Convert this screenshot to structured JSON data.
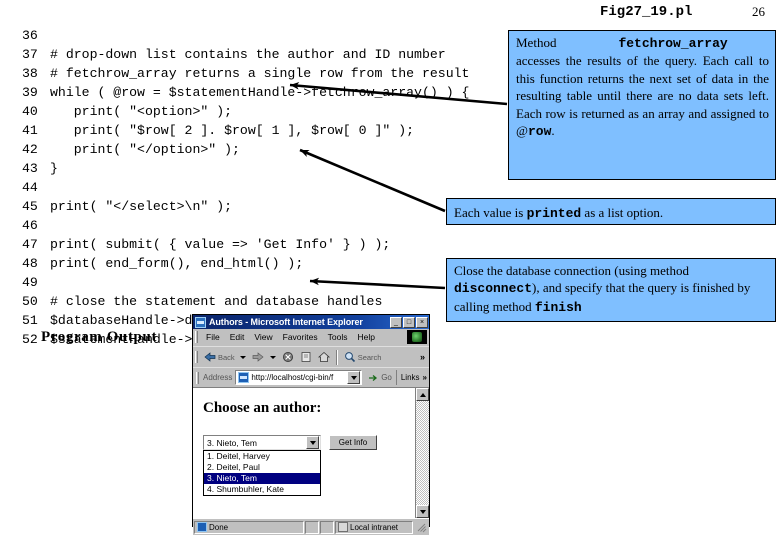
{
  "header": {
    "figure_title": "Fig27_19.pl",
    "page_number": "26"
  },
  "code": {
    "lines": [
      {
        "no": "36",
        "text": ""
      },
      {
        "no": "37",
        "text": "# drop-down list contains the author and ID number"
      },
      {
        "no": "38",
        "text": "# fetchrow_array returns a single row from the result"
      },
      {
        "no": "39",
        "text": "while ( @row = $statementHandle->fetchrow_array() ) {"
      },
      {
        "no": "40",
        "text": "   print( \"<option>\" );"
      },
      {
        "no": "41",
        "text": "   print( \"$row[ 2 ]. $row[ 1 ], $row[ 0 ]\" );"
      },
      {
        "no": "42",
        "text": "   print( \"</option>\" );"
      },
      {
        "no": "43",
        "text": "}"
      },
      {
        "no": "44",
        "text": ""
      },
      {
        "no": "45",
        "text": "print( \"</select>\\n\" );"
      },
      {
        "no": "46",
        "text": ""
      },
      {
        "no": "47",
        "text": "print( submit( { value => 'Get Info' } ) );"
      },
      {
        "no": "48",
        "text": "print( end_form(), end_html() );"
      },
      {
        "no": "49",
        "text": ""
      },
      {
        "no": "50",
        "text": "# close the statement and database handles"
      },
      {
        "no": "51",
        "text": "$databaseHandle->disconnect();"
      },
      {
        "no": "52",
        "text": "$statementHandle->finish();"
      }
    ]
  },
  "callouts": {
    "fetchrow": {
      "lead_label": "Method",
      "lead_code": "fetchrow_array",
      "body_part1": "accesses the results of the query. Each call to this function returns the next set of data in the resulting table until there are no data sets left. Each row is returned as an array and assigned to @",
      "body_code2": "row",
      "body_part3": "."
    },
    "printed": {
      "part1": "Each value is ",
      "code1": "printed",
      "part2": " as a list option."
    },
    "close": {
      "part1": "Close the database connection (using method ",
      "code1": "disconnect",
      "part2": "), and specify that the query is finished by calling method ",
      "code2": "finish"
    }
  },
  "program_output": {
    "label": "Program Output"
  },
  "browser": {
    "title": "Authors - Microsoft Internet Explorer",
    "window_buttons": {
      "minimize": "_",
      "maximize": "□",
      "close": "×"
    },
    "menu_items": [
      "File",
      "Edit",
      "View",
      "Favorites",
      "Tools",
      "Help"
    ],
    "toolbar": {
      "back": "Back",
      "forward": "",
      "stop": "",
      "refresh": "",
      "home": "",
      "search": "Search",
      "overflow": "»"
    },
    "address": {
      "label": "Address",
      "value": "http://localhost/cgi-bin/f",
      "go_label": "Go",
      "links_label": "Links",
      "links_overflow": "»"
    },
    "page": {
      "heading": "Choose an author:",
      "selected_option": "3. Nieto, Tem",
      "submit_label": "Get Info",
      "options": [
        "1. Deitel, Harvey",
        "2. Deitel, Paul",
        "3. Nieto, Tem",
        "4. Shumbuhler, Kate"
      ],
      "selected_index": 2
    },
    "status": {
      "main": "Done",
      "zone": "Local intranet"
    }
  }
}
